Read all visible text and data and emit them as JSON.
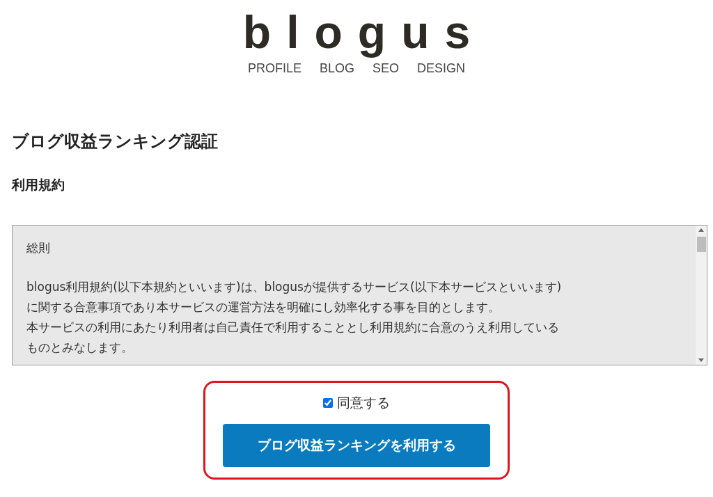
{
  "logo": "blogus",
  "nav": [
    "PROFILE",
    "BLOG",
    "SEO",
    "DESIGN"
  ],
  "page_title": "ブログ収益ランキング認証",
  "section_title": "利用規約",
  "terms": {
    "heading": "総則",
    "lines": [
      "blogus利用規約(以下本規約といいます)は、blogusが提供するサービス(以下本サービスといいます)",
      "に関する合意事項であり本サービスの運営方法を明確にし効率化する事を目的とします。",
      "本サービスの利用にあたり利用者は自己責任で利用することとし利用規約に合意のうえ利用している",
      "ものとみなします。"
    ]
  },
  "agree": {
    "label": "同意する",
    "checked": true,
    "highlighted": true
  },
  "submit_button": "ブログ収益ランキングを利用する"
}
